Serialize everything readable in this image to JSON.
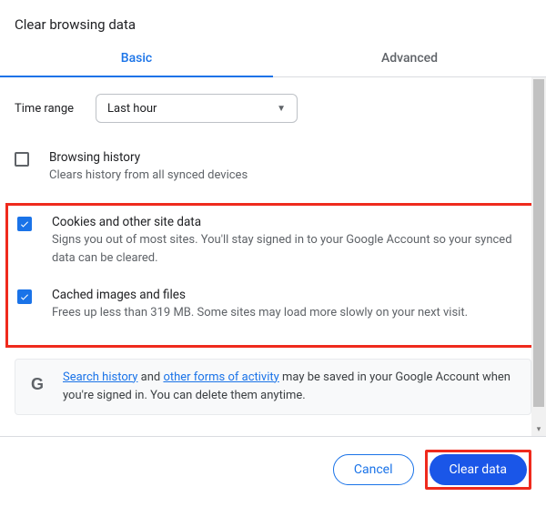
{
  "title": "Clear browsing data",
  "tabs": {
    "basic": "Basic",
    "advanced": "Advanced"
  },
  "timerange": {
    "label": "Time range",
    "value": "Last hour"
  },
  "items": {
    "browsing": {
      "heading": "Browsing history",
      "desc": "Clears history from all synced devices"
    },
    "cookies": {
      "heading": "Cookies and other site data",
      "desc": "Signs you out of most sites. You'll stay signed in to your Google Account so your synced data can be cleared."
    },
    "cache": {
      "heading": "Cached images and files",
      "desc": "Frees up less than 319 MB. Some sites may load more slowly on your next visit."
    }
  },
  "note": {
    "g": "G",
    "link1": "Search history",
    "mid1": " and ",
    "link2": "other forms of activity",
    "rest": " may be saved in your Google Account when you're signed in. You can delete them anytime."
  },
  "buttons": {
    "cancel": "Cancel",
    "clear": "Clear data"
  }
}
